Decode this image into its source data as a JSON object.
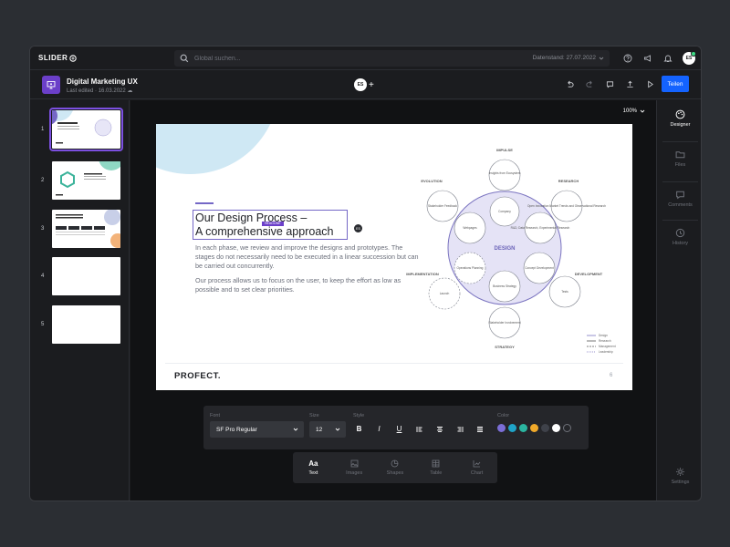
{
  "app": {
    "logo": "SLIDER"
  },
  "search": {
    "placeholder": "Global suchen..."
  },
  "datestand": "Datenstand: 27.07.2022",
  "user_initials": "ES",
  "document": {
    "title": "Digital Marketing UX",
    "last_edited": "Last edited · 16.03.2022"
  },
  "share_label": "Teilen",
  "thumbnails": [
    {
      "num": "1"
    },
    {
      "num": "2"
    },
    {
      "num": "3"
    },
    {
      "num": "4"
    },
    {
      "num": "5"
    }
  ],
  "zoom": "100%",
  "slide": {
    "title_line1": "Our Design Process –",
    "title_line2": "A comprehensive approach",
    "selection_tag": "HEADLINE",
    "body_p1": "In each phase, we review and improve the designs and prototypes. The stages do not necessarily need to be executed in a linear succession but can be carried out concurrently.",
    "body_p2": "Our process allows us to focus on the user, to keep the effort as low as possible and to set clear priorities.",
    "brand": "PROFECT.",
    "page_number": "6"
  },
  "diagram": {
    "center": "DESIGN",
    "phases": {
      "impulse": "IMPULSE",
      "research": "RESEARCH",
      "development": "DEVELOPMENT",
      "strategy": "STRATEGY",
      "implementation": "IMPLEMENTATION",
      "evolution": "EVOLUTION"
    },
    "nodes": {
      "insights": "Insights from Ecosystem",
      "company": "Company",
      "stakeholder": "Stakeholder Feedback",
      "webpages": "Webpages",
      "innovation": "Open Innovation Market Trends and Observational Research",
      "ideas": "R&D, Data Research, Experimental Research",
      "operations": "Operations Planning",
      "concept": "Concept Development",
      "business": "Business Strategy",
      "launch": "Launch",
      "tests": "Tests",
      "stakeholder_involvement": "Stakeholder Involvement"
    },
    "legend": [
      "Design",
      "Research",
      "Management",
      "Leadership"
    ]
  },
  "format_toolbar": {
    "font_label": "Font",
    "font_value": "SF Pro Regular",
    "size_label": "Size",
    "size_value": "12",
    "style_label": "Style",
    "color_label": "Color",
    "colors": [
      "#7b6ed6",
      "#1fa3c7",
      "#2bb5a0",
      "#f0a92a",
      "#3f424a",
      "#ffffff"
    ]
  },
  "insert_toolbar": [
    {
      "label": "Text",
      "icon": "text-icon"
    },
    {
      "label": "Images",
      "icon": "image-icon"
    },
    {
      "label": "Shapes",
      "icon": "shapes-icon"
    },
    {
      "label": "Table",
      "icon": "table-icon"
    },
    {
      "label": "Chart",
      "icon": "chart-icon"
    }
  ],
  "right_panel": [
    {
      "label": "Designer",
      "icon": "palette-icon"
    },
    {
      "label": "Files",
      "icon": "folder-icon"
    },
    {
      "label": "Comments",
      "icon": "comment-icon"
    },
    {
      "label": "History",
      "icon": "history-icon"
    },
    {
      "label": "Settings",
      "icon": "gear-icon"
    }
  ]
}
